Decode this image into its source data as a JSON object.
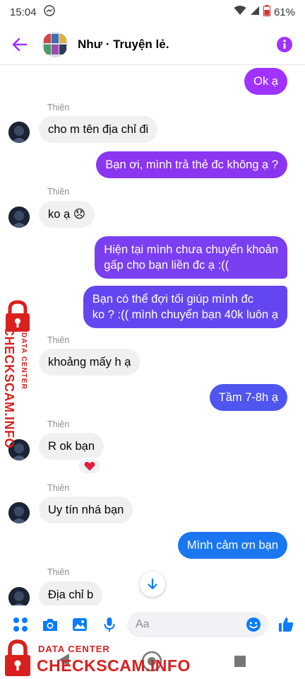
{
  "status_bar": {
    "time": "15:04",
    "battery": "61%"
  },
  "header": {
    "title": "Như · Truyện lẻ."
  },
  "colors": {
    "accent": "#a033ff",
    "brand_blue": "#0a7cff",
    "incoming_bubble": "#f0f0f0",
    "watermark": "#d9201f"
  },
  "messages": [
    {
      "dir": "out",
      "text": "Ok ạ"
    },
    {
      "dir": "in",
      "sender": "Thiên",
      "text": "cho m tên địa chỉ đi"
    },
    {
      "dir": "out",
      "text": "Bạn ơi, mình trả thẻ đc không ạ ?"
    },
    {
      "dir": "in",
      "sender": "Thiên",
      "text": "ko ạ 😞"
    },
    {
      "dir": "out",
      "lines": [
        "Hiện tại mình chưa chuyển khoản",
        "gấp cho bạn liền đc ạ :(("
      ]
    },
    {
      "dir": "out",
      "lines": [
        "Bạn có thể đợi tối giúp mình đc",
        "ko ? :(( mình chuyển bạn 40k luôn ạ"
      ]
    },
    {
      "dir": "in",
      "sender": "Thiên",
      "text": "khoảng mấy h ạ"
    },
    {
      "dir": "out",
      "text": "Tầm 7-8h ạ"
    },
    {
      "dir": "in",
      "sender": "Thiên",
      "text": "R ok bạn",
      "reaction": "heart"
    },
    {
      "dir": "in",
      "sender": "Thiên",
      "text": "Uy tín nhá bạn"
    },
    {
      "dir": "out",
      "text": "Mình cảm ơn bạn"
    },
    {
      "dir": "in",
      "sender": "Thiên",
      "text": "Địa chỉ b"
    }
  ],
  "composer": {
    "placeholder": "Aa"
  },
  "watermark": {
    "line1": "DATA CENTER",
    "line2": "CHECKSCAM.INFO"
  }
}
